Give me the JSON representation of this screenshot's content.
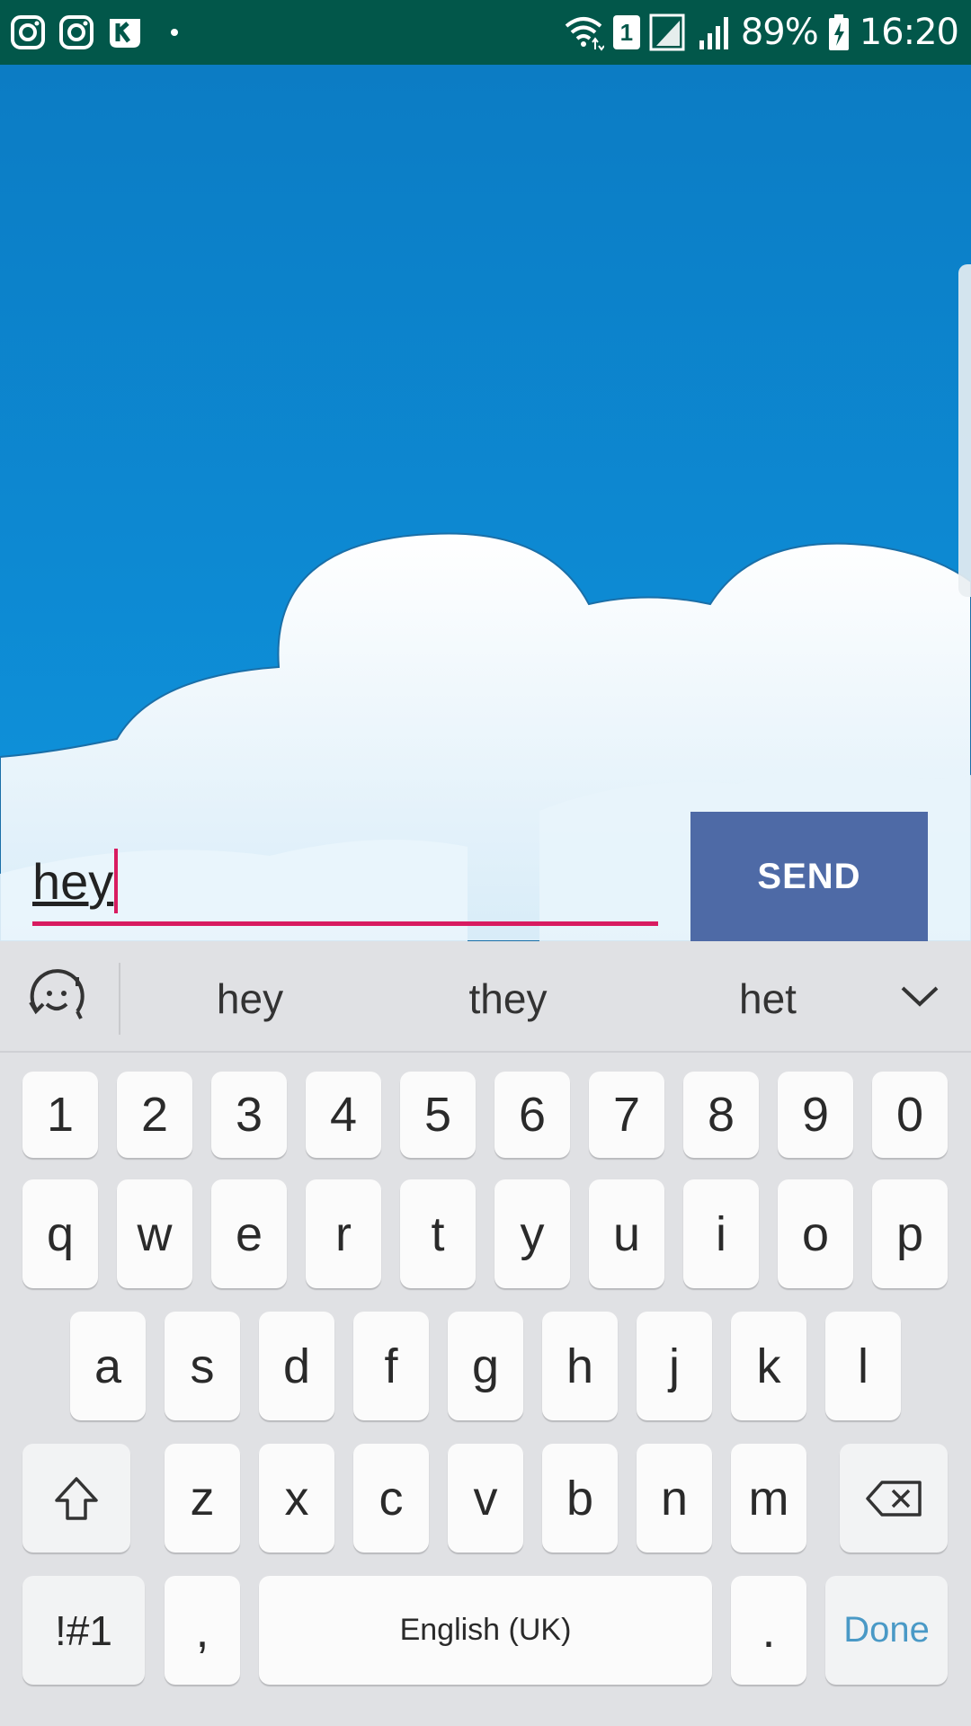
{
  "status_bar": {
    "battery": "89%",
    "time": "16:20",
    "sim_label": "1",
    "left_icons": [
      "instagram-icon",
      "instagram-icon",
      "kik-icon"
    ],
    "right_icons": [
      "wifi-icon",
      "sim-icon",
      "signal-icon",
      "signal-icon",
      "battery-charging-icon"
    ]
  },
  "compose": {
    "message_text": "hey",
    "send_label": "SEND",
    "underline_color": "#d81b60",
    "send_color": "#4e6aa6"
  },
  "keyboard": {
    "suggestions": [
      "hey",
      "they",
      "het"
    ],
    "number_row": [
      "1",
      "2",
      "3",
      "4",
      "5",
      "6",
      "7",
      "8",
      "9",
      "0"
    ],
    "row1": [
      "q",
      "w",
      "e",
      "r",
      "t",
      "y",
      "u",
      "i",
      "o",
      "p"
    ],
    "row2": [
      "a",
      "s",
      "d",
      "f",
      "g",
      "h",
      "j",
      "k",
      "l"
    ],
    "row3": [
      "z",
      "x",
      "c",
      "v",
      "b",
      "n",
      "m"
    ],
    "symbols_label": "!#1",
    "comma_label": ",",
    "space_label": "English (UK)",
    "period_label": ".",
    "done_label": "Done",
    "accent_color": "#4a99c6"
  }
}
